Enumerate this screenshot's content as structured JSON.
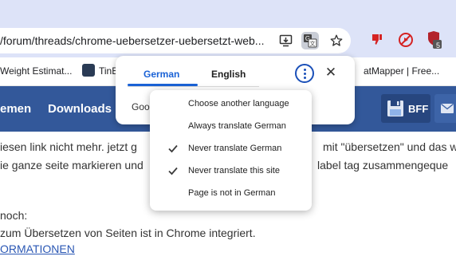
{
  "browser": {
    "url_text": "/forum/threads/chrome-uebersetzer-uebersetzt-web...",
    "extension_badge": "5",
    "bookmarks": [
      {
        "label": "Weight Estimat..."
      },
      {
        "label": "TinE"
      },
      {
        "label": "atMapper | Free..."
      }
    ]
  },
  "site": {
    "nav": [
      {
        "label": "emen"
      },
      {
        "label": "Downloads"
      }
    ],
    "bff_label": "BFF",
    "lines": [
      {
        "text": "iesen link nicht mehr. jetzt g"
      },
      {
        "text": "mit \"übersetzen\" und das w"
      },
      {
        "text": "ie ganze seite markieren und"
      },
      {
        "text": "label tag zusammengeque"
      },
      {
        "text": "noch:"
      },
      {
        "text": "zum Übersetzen von Seiten ist in Chrome integriert."
      },
      {
        "text": "ORMATIONEN"
      }
    ]
  },
  "translate_bubble": {
    "tabs": [
      {
        "label": "German",
        "selected": true
      },
      {
        "label": "English",
        "selected": false
      }
    ],
    "footer_text": "Goo",
    "menu": [
      {
        "label": "Choose another language",
        "checked": false
      },
      {
        "label": "Always translate German",
        "checked": false
      },
      {
        "label": "Never translate German",
        "checked": true
      },
      {
        "label": "Never translate this site",
        "checked": true
      },
      {
        "label": "Page is not in German",
        "checked": false
      }
    ]
  },
  "colors": {
    "accent": "#1a62d6",
    "chrome_frame": "#dde3f8",
    "site_nav": "#33589a",
    "link": "#2a57b4"
  },
  "icons": {
    "install": "install-app-icon",
    "translate": "translate-icon",
    "bookmark": "star-icon",
    "menu": "more-vert-icon",
    "close": "close-icon",
    "check": "check-icon"
  }
}
